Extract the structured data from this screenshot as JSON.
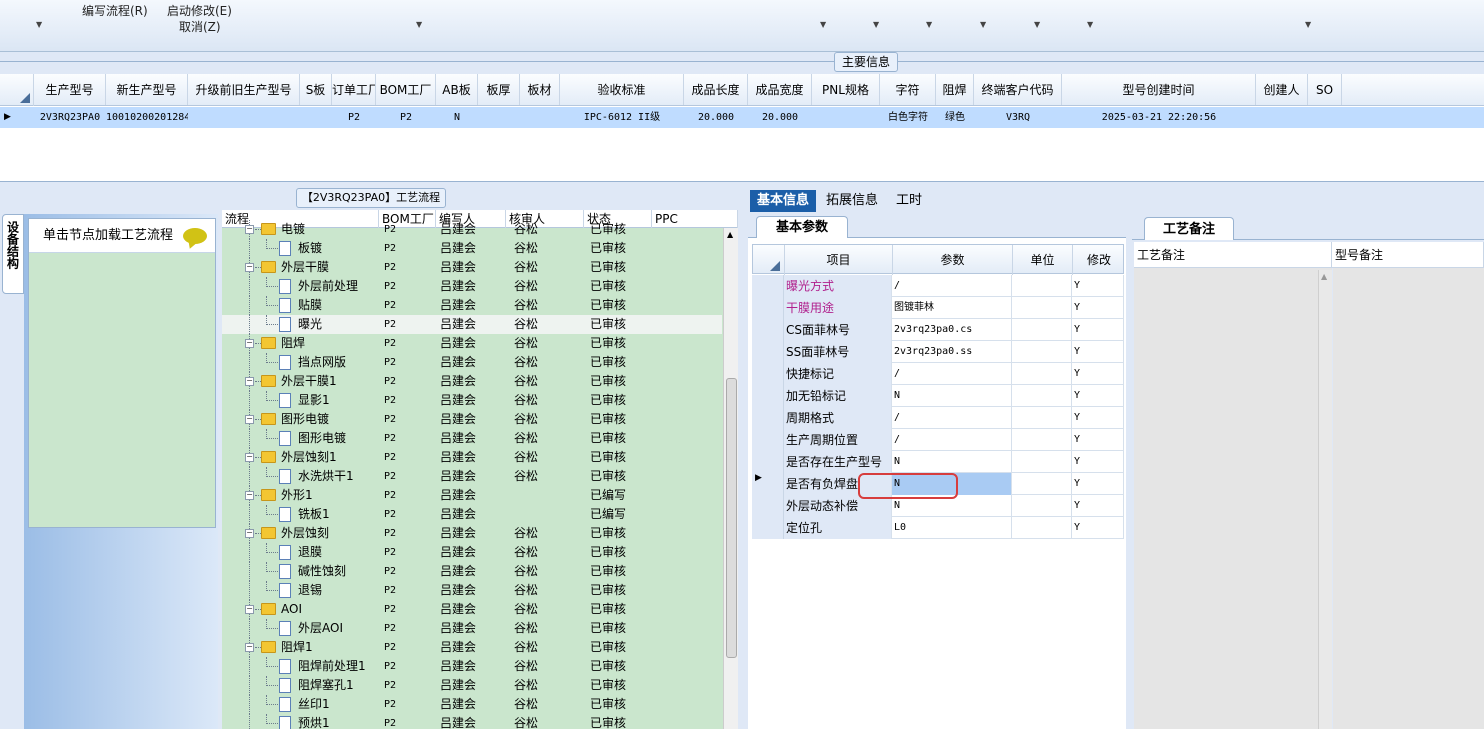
{
  "toolbar": {
    "items": [
      {
        "label": "编写流程(R)"
      },
      {
        "label": "启动修改(E)"
      },
      {
        "label": "取消(Z)"
      }
    ]
  },
  "main_info": {
    "title": "主要信息",
    "columns": [
      "生产型号",
      "新生产型号",
      "升级前旧生产型号",
      "S板",
      "订单工厂",
      "BOM工厂",
      "AB板",
      "板厚",
      "板材",
      "验收标准",
      "成品长度",
      "成品宽度",
      "PNL规格",
      "字符",
      "阻焊",
      "终端客户代码",
      "型号创建时间",
      "创建人",
      "SO"
    ],
    "rows": [
      [
        "2V3RQ23PA0",
        "10010200201284",
        "",
        "",
        "P2",
        "P2",
        "N",
        "",
        "",
        "IPC-6012 II级",
        "20.000",
        "20.000",
        "",
        "白色字符",
        "绿色",
        "V3RQ",
        "2025-03-21 22:20:56",
        "",
        ""
      ]
    ]
  },
  "flow_panel": {
    "title": "【2V3RQ23PA0】工艺流程",
    "side_tab": "设备结构",
    "load_button": "单击节点加载工艺流程",
    "columns": [
      "流程",
      "BOM工厂",
      "编写人",
      "核审人",
      "状态",
      "PPC"
    ],
    "rows": [
      {
        "level": 0,
        "name": "电镀",
        "bom": "P2",
        "writer": "吕建会",
        "reviewer": "谷松",
        "status": "已审核"
      },
      {
        "level": 1,
        "name": "板镀",
        "bom": "P2",
        "writer": "吕建会",
        "reviewer": "谷松",
        "status": "已审核"
      },
      {
        "level": 0,
        "name": "外层干膜",
        "bom": "P2",
        "writer": "吕建会",
        "reviewer": "谷松",
        "status": "已审核"
      },
      {
        "level": 1,
        "name": "外层前处理",
        "bom": "P2",
        "writer": "吕建会",
        "reviewer": "谷松",
        "status": "已审核"
      },
      {
        "level": 1,
        "name": "贴膜",
        "bom": "P2",
        "writer": "吕建会",
        "reviewer": "谷松",
        "status": "已审核"
      },
      {
        "level": 1,
        "name": "曝光",
        "bom": "P2",
        "writer": "吕建会",
        "reviewer": "谷松",
        "status": "已审核",
        "selected": true
      },
      {
        "level": 0,
        "name": "阻焊",
        "bom": "P2",
        "writer": "吕建会",
        "reviewer": "谷松",
        "status": "已审核"
      },
      {
        "level": 1,
        "name": "挡点网版",
        "bom": "P2",
        "writer": "吕建会",
        "reviewer": "谷松",
        "status": "已审核"
      },
      {
        "level": 0,
        "name": "外层干膜1",
        "bom": "P2",
        "writer": "吕建会",
        "reviewer": "谷松",
        "status": "已审核"
      },
      {
        "level": 1,
        "name": "显影1",
        "bom": "P2",
        "writer": "吕建会",
        "reviewer": "谷松",
        "status": "已审核"
      },
      {
        "level": 0,
        "name": "图形电镀",
        "bom": "P2",
        "writer": "吕建会",
        "reviewer": "谷松",
        "status": "已审核"
      },
      {
        "level": 1,
        "name": "图形电镀",
        "bom": "P2",
        "writer": "吕建会",
        "reviewer": "谷松",
        "status": "已审核"
      },
      {
        "level": 0,
        "name": "外层蚀刻1",
        "bom": "P2",
        "writer": "吕建会",
        "reviewer": "谷松",
        "status": "已审核"
      },
      {
        "level": 1,
        "name": "水洗烘干1",
        "bom": "P2",
        "writer": "吕建会",
        "reviewer": "谷松",
        "status": "已审核"
      },
      {
        "level": 0,
        "name": "外形1",
        "bom": "P2",
        "writer": "吕建会",
        "reviewer": "",
        "status": "已编写"
      },
      {
        "level": 1,
        "name": "铣板1",
        "bom": "P2",
        "writer": "吕建会",
        "reviewer": "",
        "status": "已编写"
      },
      {
        "level": 0,
        "name": "外层蚀刻",
        "bom": "P2",
        "writer": "吕建会",
        "reviewer": "谷松",
        "status": "已审核"
      },
      {
        "level": 1,
        "name": "退膜",
        "bom": "P2",
        "writer": "吕建会",
        "reviewer": "谷松",
        "status": "已审核"
      },
      {
        "level": 1,
        "name": "碱性蚀刻",
        "bom": "P2",
        "writer": "吕建会",
        "reviewer": "谷松",
        "status": "已审核"
      },
      {
        "level": 1,
        "name": "退锡",
        "bom": "P2",
        "writer": "吕建会",
        "reviewer": "谷松",
        "status": "已审核"
      },
      {
        "level": 0,
        "name": "AOI",
        "bom": "P2",
        "writer": "吕建会",
        "reviewer": "谷松",
        "status": "已审核"
      },
      {
        "level": 1,
        "name": "外层AOI",
        "bom": "P2",
        "writer": "吕建会",
        "reviewer": "谷松",
        "status": "已审核"
      },
      {
        "level": 0,
        "name": "阻焊1",
        "bom": "P2",
        "writer": "吕建会",
        "reviewer": "谷松",
        "status": "已审核"
      },
      {
        "level": 1,
        "name": "阻焊前处理1",
        "bom": "P2",
        "writer": "吕建会",
        "reviewer": "谷松",
        "status": "已审核"
      },
      {
        "level": 1,
        "name": "阻焊塞孔1",
        "bom": "P2",
        "writer": "吕建会",
        "reviewer": "谷松",
        "status": "已审核"
      },
      {
        "level": 1,
        "name": "丝印1",
        "bom": "P2",
        "writer": "吕建会",
        "reviewer": "谷松",
        "status": "已审核"
      },
      {
        "level": 1,
        "name": "预烘1",
        "bom": "P2",
        "writer": "吕建会",
        "reviewer": "谷松",
        "status": "已审核"
      }
    ]
  },
  "info_panel": {
    "tabs": [
      "基本信息",
      "拓展信息",
      "工时"
    ],
    "sub_tab": "基本参数",
    "columns": [
      "项目",
      "参数",
      "单位",
      "修改"
    ],
    "rows": [
      {
        "item": "曝光方式",
        "value": "/",
        "unit": "",
        "modify": "Y",
        "pink": true
      },
      {
        "item": "干膜用途",
        "value": "图镀菲林",
        "unit": "",
        "modify": "Y",
        "pink": true
      },
      {
        "item": "CS面菲林号",
        "value": "2v3rq23pa0.cs",
        "unit": "",
        "modify": "Y"
      },
      {
        "item": "SS面菲林号",
        "value": "2v3rq23pa0.ss",
        "unit": "",
        "modify": "Y"
      },
      {
        "item": "快捷标记",
        "value": "/",
        "unit": "",
        "modify": "Y"
      },
      {
        "item": "加无铅标记",
        "value": "N",
        "unit": "",
        "modify": "Y"
      },
      {
        "item": "周期格式",
        "value": "/",
        "unit": "",
        "modify": "Y"
      },
      {
        "item": "生产周期位置",
        "value": "/",
        "unit": "",
        "modify": "Y"
      },
      {
        "item": "是否存在生产型号",
        "value": "N",
        "unit": "",
        "modify": "Y"
      },
      {
        "item": "是否有负焊盘",
        "value": "N",
        "unit": "",
        "modify": "Y",
        "current": true
      },
      {
        "item": "外层动态补偿",
        "value": "N",
        "unit": "",
        "modify": "Y"
      },
      {
        "item": "定位孔",
        "value": "L0",
        "unit": "",
        "modify": "Y"
      }
    ]
  },
  "remark_panel": {
    "tab": "工艺备注",
    "columns": [
      "工艺备注",
      "型号备注"
    ]
  }
}
